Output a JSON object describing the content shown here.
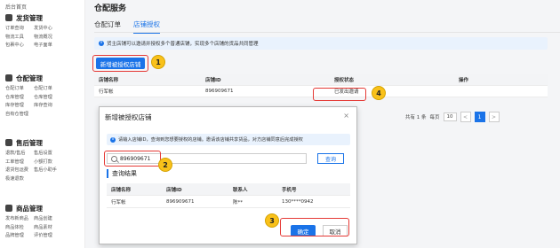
{
  "sidebar": {
    "top": "后台首页",
    "groups": [
      {
        "title": "发货管理",
        "items": [
          "订单查询",
          "发货中心",
          "物流工具",
          "物流概况",
          "包裹中心",
          "电子面单"
        ]
      },
      {
        "title": "仓配管理",
        "items": [
          "仓配订单",
          "仓配订单",
          "仓库管理",
          "仓库管理",
          "库存管理",
          "库存查询",
          "自有仓管理"
        ]
      },
      {
        "title": "售后管理",
        "items": [
          "退款/售后",
          "售后设置",
          "工单管理",
          "小额打款",
          "退货包运费",
          "售后小助手",
          "极速退款"
        ]
      },
      {
        "title": "商品管理",
        "items": [
          "发布新商品",
          "商品创建",
          "商品体检",
          "商品素材",
          "品牌管理",
          "评价管理"
        ]
      }
    ]
  },
  "page": {
    "title": "仓配服务",
    "tabs": [
      "仓配订单",
      "店铺授权"
    ]
  },
  "info": "货主店铺可以邀请并授权多个普通店铺，实现多个店铺的货品共同管理",
  "add_button": "新增被授权店铺",
  "table": {
    "headers": [
      "店铺名称",
      "店铺ID",
      "授权状态",
      "操作"
    ],
    "rows": [
      [
        "行军帐",
        "896909671",
        "已发出邀请",
        ""
      ]
    ]
  },
  "pager": {
    "total": "共有 1 条",
    "per_page_label": "每页",
    "per_page": "10",
    "page": "1",
    "prev": "<",
    "next": ">"
  },
  "modal": {
    "title": "新增被授权店铺",
    "close": "×",
    "info": "请输入店铺ID，查询到您想要授权的店铺。邀请该店铺共享货品，对方店铺同意后完成授权",
    "search_value": "896909671",
    "query_button": "查询",
    "result_title": "查询结果",
    "headers": [
      "店铺名称",
      "店铺ID",
      "联系人",
      "手机号"
    ],
    "rows": [
      [
        "行军帐",
        "896909671",
        "陈**",
        "130****0942"
      ]
    ],
    "ok": "确定",
    "cancel": "取消"
  },
  "badges": [
    "1",
    "2",
    "3",
    "4"
  ],
  "colors": {
    "accent": "#1a73e8",
    "highlight": "#e53935",
    "badge": "#f9c11a"
  }
}
